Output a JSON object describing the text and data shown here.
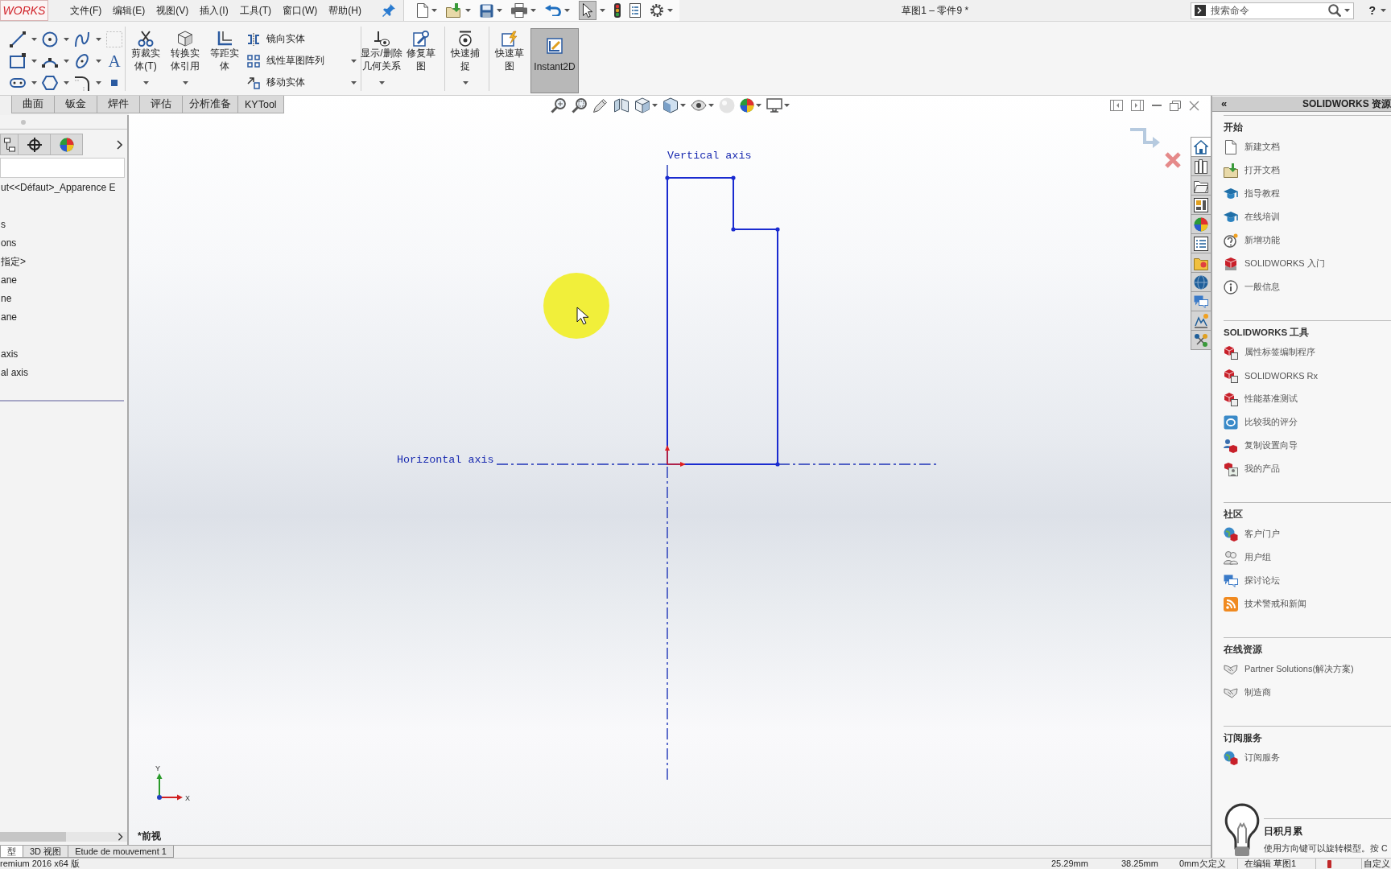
{
  "menu_bar": {
    "logo": "WORKS",
    "menus": [
      "文件(F)",
      "编辑(E)",
      "视图(V)",
      "插入(I)",
      "工具(T)",
      "窗口(W)",
      "帮助(H)"
    ],
    "title": "草图1 – 零件9 *",
    "search": {
      "placeholder": "搜索命令"
    },
    "help": "?"
  },
  "command_manager": {
    "text_tool": "A",
    "groups": [
      {
        "buttons": [
          {
            "label": "剪裁实体(T)",
            "dropdown": true,
            "selected": false
          },
          {
            "label": "转换实体引用",
            "dropdown": true,
            "selected": false
          },
          {
            "label": "等距实体",
            "dropdown": false,
            "selected": false
          }
        ],
        "stacked": [
          {
            "label": "镜向实体",
            "dropdown": false
          },
          {
            "label": "线性草图阵列",
            "dropdown": true
          },
          {
            "label": "移动实体",
            "dropdown": true
          }
        ]
      },
      {
        "buttons": [
          {
            "label": "显示/删除几何关系",
            "dropdown": true,
            "selected": false
          },
          {
            "label": "修复草图",
            "dropdown": false,
            "selected": false
          }
        ]
      },
      {
        "buttons": [
          {
            "label": "快速捕捉",
            "dropdown": true,
            "selected": false
          }
        ]
      },
      {
        "buttons": [
          {
            "label": "快速草图",
            "dropdown": false,
            "selected": false
          },
          {
            "label": "Instant2D",
            "dropdown": false,
            "selected": true
          }
        ]
      }
    ]
  },
  "command_tabs": [
    {
      "label": "曲面",
      "selected": false
    },
    {
      "label": "钣金",
      "selected": false
    },
    {
      "label": "焊件",
      "selected": false
    },
    {
      "label": "评估",
      "selected": false
    },
    {
      "label": "分析准备",
      "selected": false
    },
    {
      "label": "KYTool",
      "selected": false
    }
  ],
  "feature_tree": {
    "items": [
      "ut<<Défaut>_Apparence E",
      "s",
      "ons",
      "指定>",
      "ane",
      "ne",
      "ane",
      "axis",
      "al axis"
    ]
  },
  "graphics": {
    "vertical_axis": "Vertical axis",
    "horizontal_axis": "Horizontal axis",
    "triad": {
      "x": "X",
      "y": "Y"
    },
    "view_name": "*前视"
  },
  "task_pane": {
    "collapse": "«",
    "title": "SOLIDWORKS 资源",
    "tabs": [
      {
        "selected": true
      },
      {
        "selected": false
      },
      {
        "selected": false
      },
      {
        "selected": false
      },
      {
        "selected": false
      },
      {
        "selected": false
      },
      {
        "selected": false
      },
      {
        "selected": false
      },
      {
        "selected": false
      },
      {
        "selected": false
      },
      {
        "selected": false
      }
    ],
    "sections": [
      {
        "heading": "开始",
        "items": [
          "新建文档",
          "打开文档",
          "指导教程",
          "在线培训",
          "新增功能",
          "SOLIDWORKS 入门",
          "一般信息"
        ]
      },
      {
        "heading": "SOLIDWORKS 工具",
        "items": [
          "属性标签编制程序",
          "SOLIDWORKS Rx",
          "性能基准测试",
          "比较我的评分",
          "复制设置向导",
          "我的产品"
        ]
      },
      {
        "heading": "社区",
        "items": [
          "客户门户",
          "用户组",
          "探讨论坛",
          "技术警戒和新闻"
        ]
      },
      {
        "heading": "在线资源",
        "items": [
          "Partner Solutions(解决方案)",
          "制造商"
        ]
      },
      {
        "heading": "订阅服务",
        "items": [
          "订阅服务"
        ]
      }
    ],
    "tip": {
      "heading": "日积月累",
      "text": "使用方向键可以旋转模型。按 C"
    }
  },
  "document_tabs": [
    {
      "label": "型",
      "selected": true
    },
    {
      "label": "3D 视图",
      "selected": false
    },
    {
      "label": "Etude de mouvement 1",
      "selected": false
    }
  ],
  "status_bar": {
    "product": "remium 2016 x64 版",
    "x": "25.29mm",
    "y": "38.25mm",
    "z": "0mm",
    "sketch_state": "欠定义",
    "editing": "在编辑 草图1",
    "units": "自定义"
  }
}
